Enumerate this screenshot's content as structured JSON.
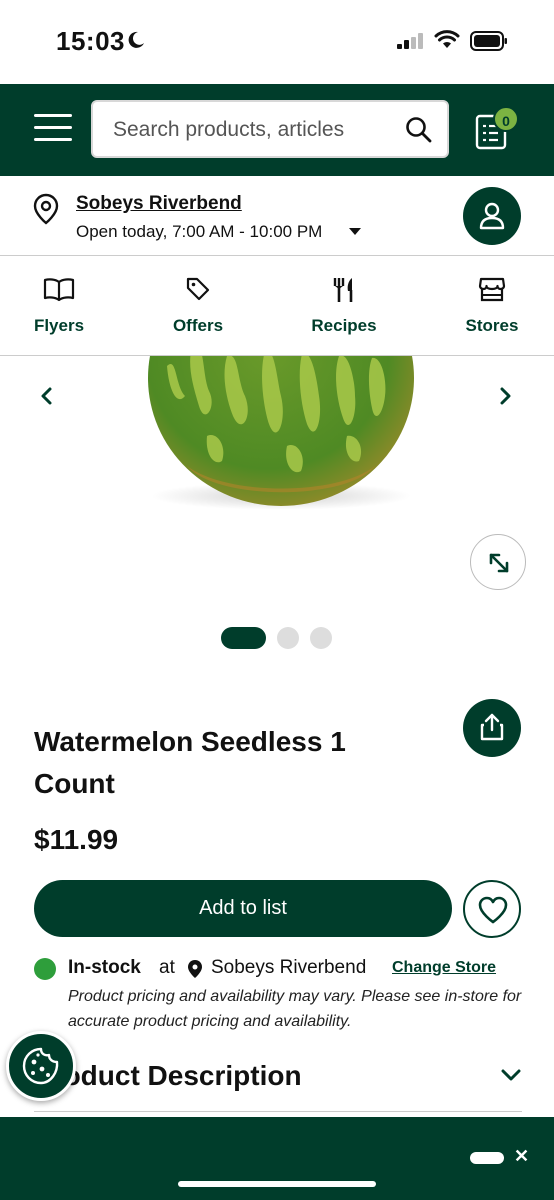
{
  "status_bar": {
    "time": "15:03"
  },
  "header": {
    "search_placeholder": "Search products, articles",
    "list_count": "0"
  },
  "store": {
    "name": "Sobeys Riverbend",
    "hours": "Open today, 7:00 AM - 10:00 PM"
  },
  "nav": {
    "items": [
      {
        "label": "Flyers",
        "icon": "book-open-icon"
      },
      {
        "label": "Offers",
        "icon": "tag-icon"
      },
      {
        "label": "Recipes",
        "icon": "utensils-icon"
      },
      {
        "label": "Stores",
        "icon": "storefront-icon"
      }
    ]
  },
  "gallery": {
    "image_count": 3,
    "active_index": 0
  },
  "product": {
    "title": "Watermelon Seedless 1 Count",
    "price": "$11.99",
    "add_label": "Add to list"
  },
  "stock": {
    "status": "In-stock",
    "at": "at",
    "store": "Sobeys Riverbend",
    "change_label": "Change Store",
    "disclaimer": "Product pricing and availability may vary. Please see in-store for accurate product pricing and availability."
  },
  "description": {
    "title": "Product Description"
  },
  "colors": {
    "brand_green": "#003d2b",
    "badge_green": "#7cb342",
    "stock_green": "#2e9e3b"
  }
}
